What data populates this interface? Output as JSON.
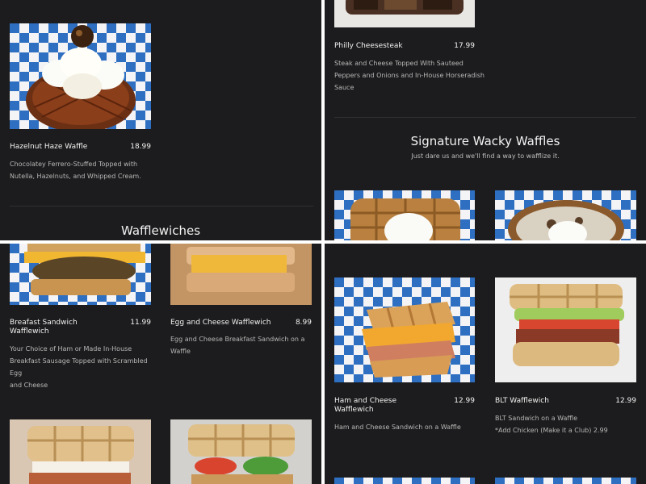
{
  "top_left": {
    "item": {
      "name": "Hazelnut Haze Waffle",
      "price": "18.99",
      "description_lines": [
        "Chocolatey Ferrero-Stuffed Topped with",
        "Nutella, Hazelnuts, and Whipped Cream."
      ]
    },
    "section_title": "Wafflewiches"
  },
  "top_right": {
    "item": {
      "name": "Philly Cheesesteak",
      "price": "17.99",
      "description_lines": [
        "Steak and Cheese Topped With Sauteed",
        "Peppers and Onions and In-House Horseradish",
        "Sauce"
      ]
    },
    "section_title": "Signature Wacky Waffles",
    "section_subtitle": "Just dare us and we'll find a way to wafflize it."
  },
  "bottom_left": {
    "items": [
      {
        "name_lines": [
          "Breafast Sandwich",
          "Wafflewich"
        ],
        "price": "11.99",
        "description_lines": [
          "Your Choice of Ham or Made In-House",
          "Breakfast Sausage Topped with Scrambled Egg",
          "and Cheese"
        ]
      },
      {
        "name_lines": [
          "Egg and Cheese Wafflewich"
        ],
        "price": "8.99",
        "description_lines": [
          "Egg and Cheese Breakfast Sandwich on a",
          "Waffle"
        ]
      }
    ]
  },
  "bottom_right": {
    "items": [
      {
        "name_lines": [
          "Ham and Cheese",
          "Wafflewich"
        ],
        "price": "12.99",
        "description_lines": [
          "Ham and Cheese Sandwich on a Waffle"
        ]
      },
      {
        "name_lines": [
          "BLT Wafflewich"
        ],
        "price": "12.99",
        "description_lines": [
          "BLT Sandwich on a Waffle",
          "*Add Chicken (Make it a Club) 2.99"
        ]
      }
    ]
  },
  "colors": {
    "background": "#1c1c1e",
    "checker_blue": "#2f6fc1",
    "checker_white": "#f4f4f6",
    "divider": "#303033"
  }
}
